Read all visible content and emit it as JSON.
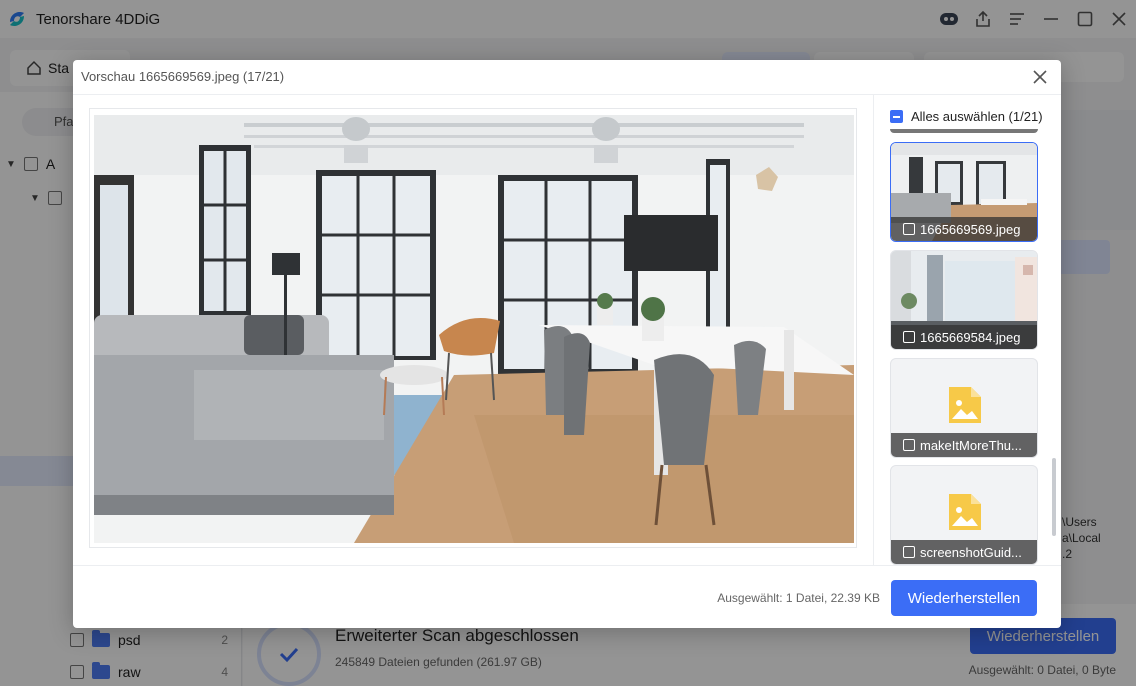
{
  "app": {
    "title": "Tenorshare 4DDiG"
  },
  "topbar": {
    "start_tab": "Sta",
    "path_chip": "Pfa"
  },
  "sidebar": {
    "root_label": "A",
    "items": [
      {
        "label": "psd",
        "count": "2"
      },
      {
        "label": "raw",
        "count": "4"
      }
    ]
  },
  "right_panel": {
    "path_lines": [
      "\\Users",
      "a\\Local",
      ".2"
    ]
  },
  "status": {
    "scan_title": "Erweiterter Scan abgeschlossen",
    "scan_sub": "245849 Dateien gefunden (261.97 GB)",
    "recover_label": "Wiederherstellen",
    "selected_text": "Ausgewählt: 0 Datei, 0 Byte"
  },
  "preview": {
    "title": "Vorschau 1665669569.jpeg (17/21)",
    "select_all": "Alles auswählen (1/21)",
    "thumbnails": [
      {
        "name": "1665669569.jpeg",
        "type": "photo",
        "active": true
      },
      {
        "name": "1665669584.jpeg",
        "type": "photo",
        "active": false
      },
      {
        "name": "makeItMoreThu...",
        "type": "placeholder",
        "active": false
      },
      {
        "name": "screenshotGuid...",
        "type": "placeholder",
        "active": false
      }
    ],
    "footer_selected": "Ausgewählt: 1 Datei, 22.39 KB",
    "recover_label": "Wiederherstellen"
  },
  "colors": {
    "accent": "#3b6df6",
    "overlay": "rgba(0,0,0,0.42)"
  }
}
